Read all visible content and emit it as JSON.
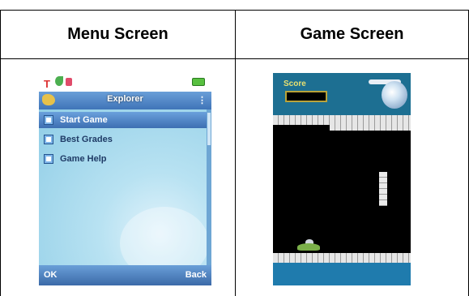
{
  "table": {
    "headers": [
      "Menu Screen",
      "Game Screen"
    ]
  },
  "menu_screen": {
    "title": "Explorer",
    "items": [
      {
        "label": "Start Game",
        "selected": true
      },
      {
        "label": "Best Grades",
        "selected": false
      },
      {
        "label": "Game Help",
        "selected": false
      }
    ],
    "softkeys": {
      "left": "OK",
      "right": "Back"
    },
    "colors": {
      "bar": "#4a82c6",
      "body": "#a9dcef"
    }
  },
  "game_screen": {
    "score_label": "Score",
    "colors": {
      "sky": "#1d6f92",
      "cave": "#000000",
      "bricks": "#e6e6e6"
    }
  }
}
